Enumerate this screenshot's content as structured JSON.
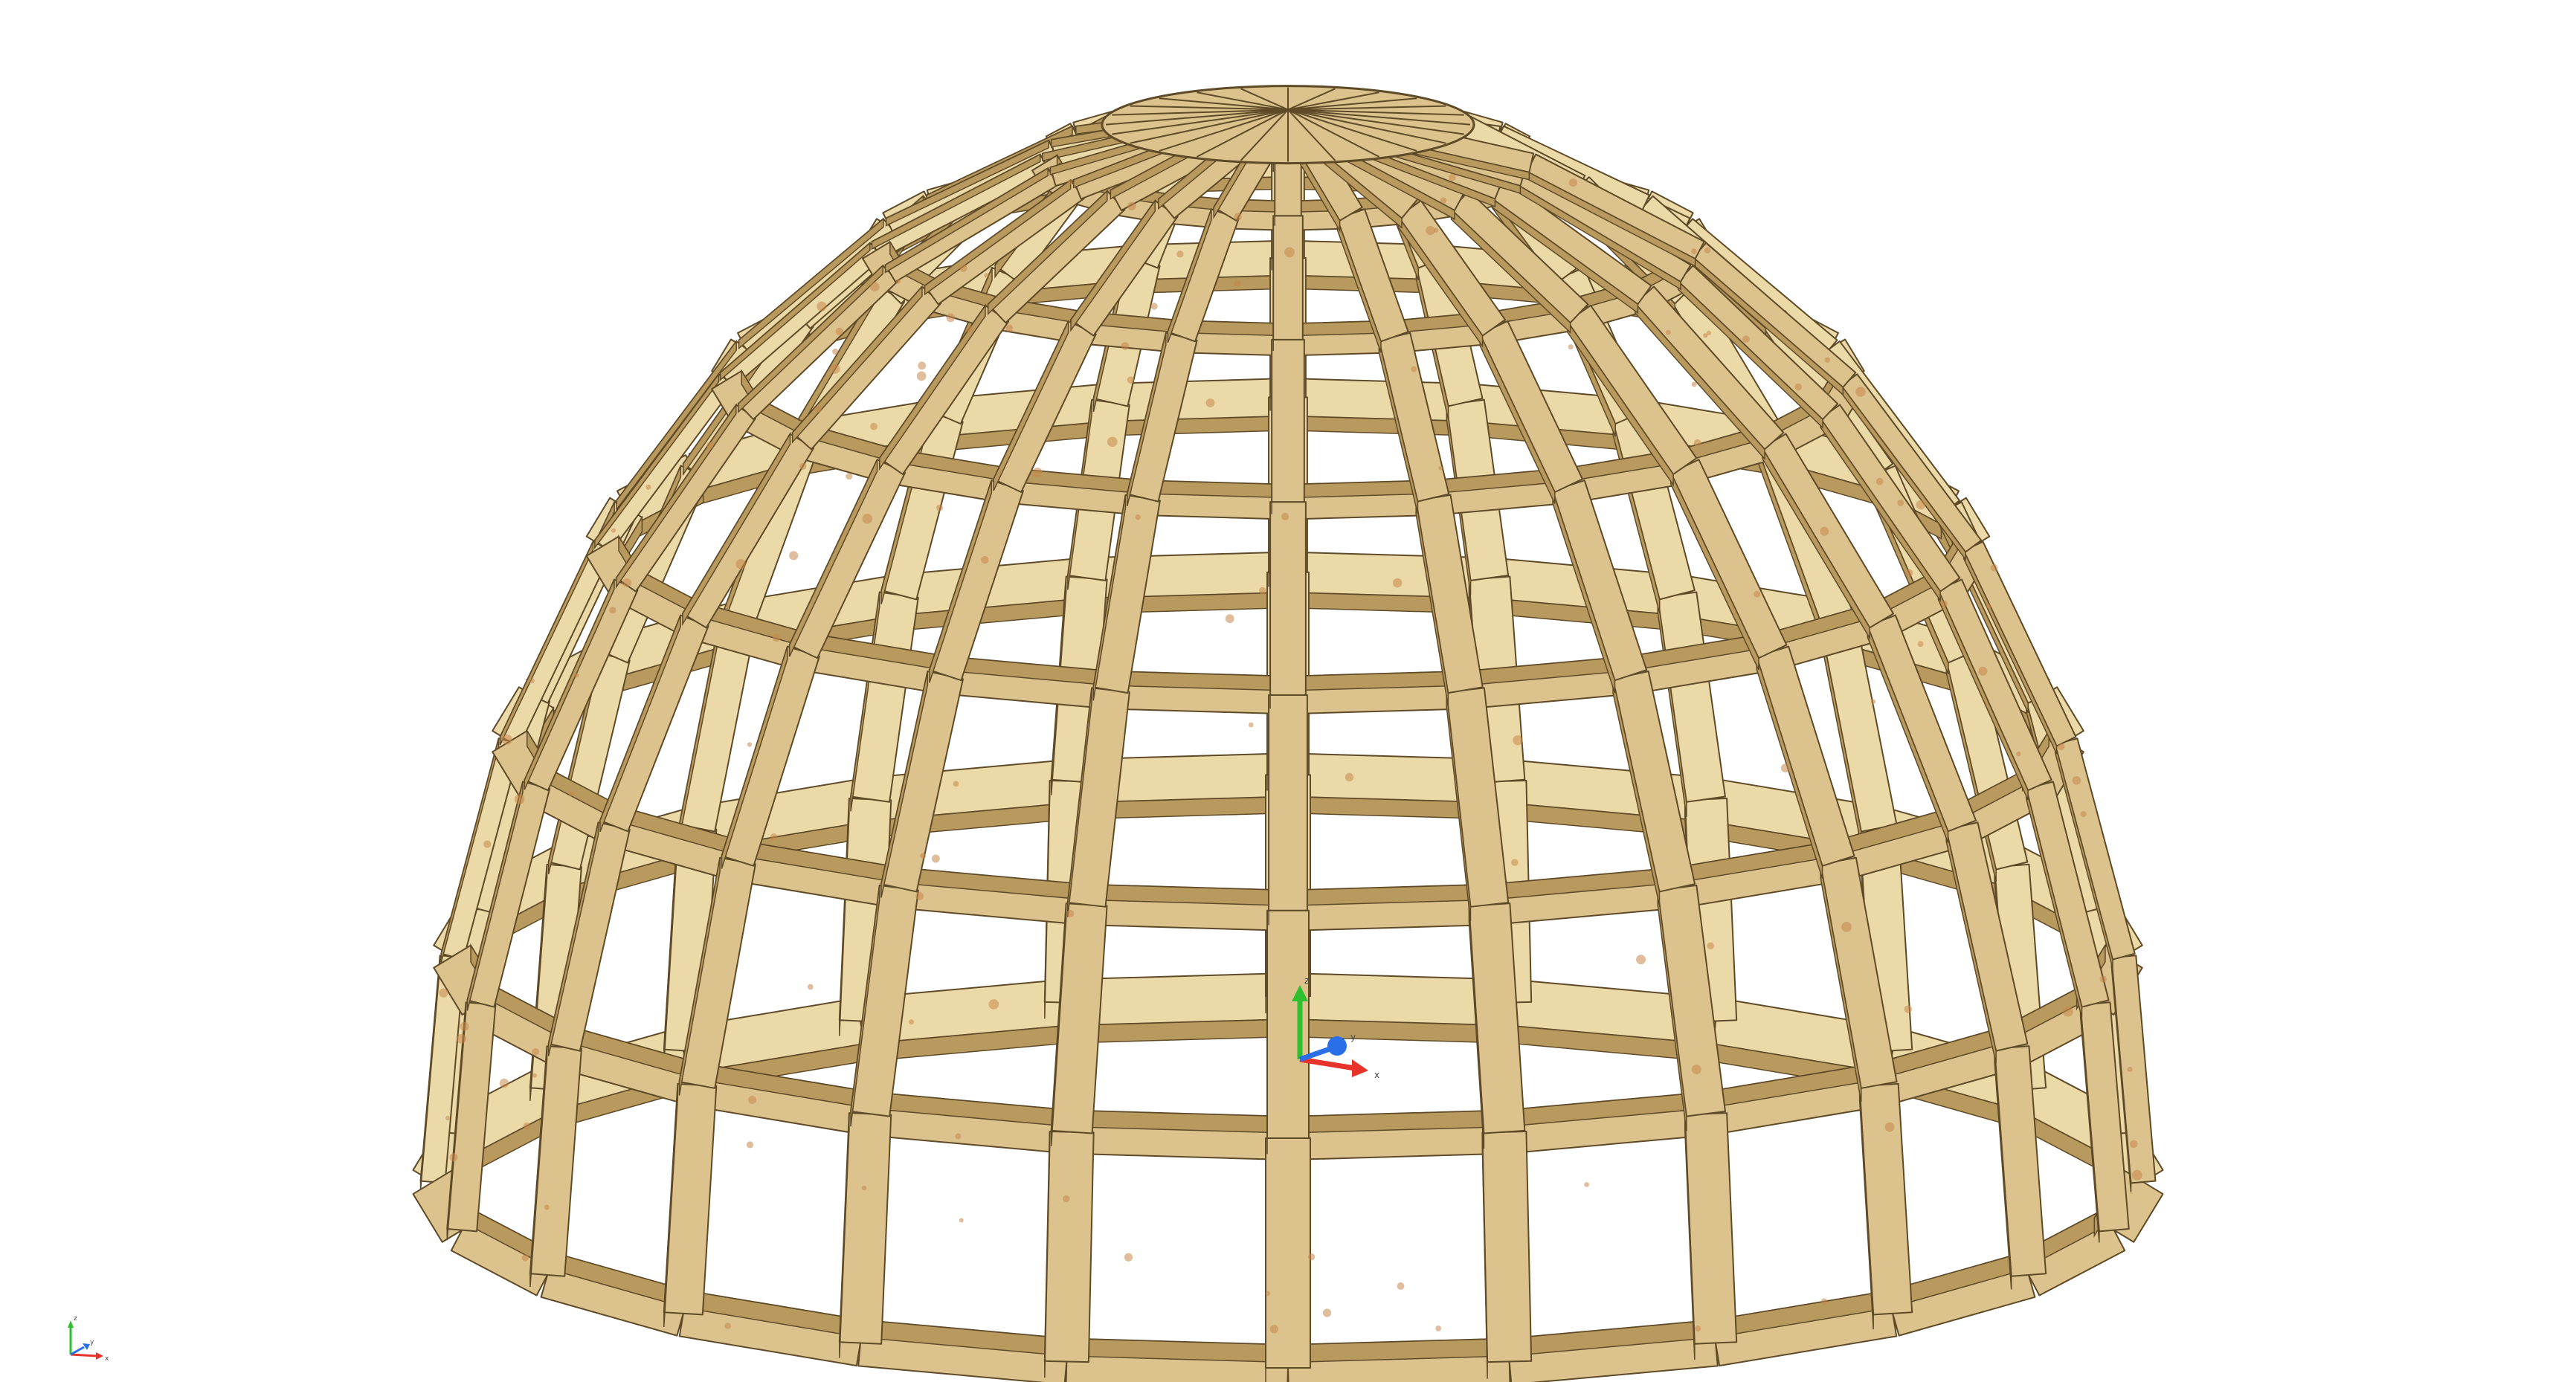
{
  "viewport": {
    "background": "#ffffff"
  },
  "model": {
    "name_icon": "timber-dome-frame",
    "rings": 7,
    "ribs": 24,
    "colors": {
      "wood_face": "#dcc38e",
      "wood_side": "#b99a5e",
      "wood_dark": "#8c7142",
      "wood_light": "#ecd9a8",
      "knot": "#c7874a",
      "edge": "#5f4a28"
    }
  },
  "axis_triad_center": {
    "labels": {
      "x": "x",
      "y": "y",
      "z": "z"
    },
    "colors": {
      "x": "#e8332a",
      "y": "#2a6fe8",
      "z": "#2ec02e"
    }
  },
  "axis_triad_corner": {
    "labels": {
      "x": "x",
      "y": "y",
      "z": "z"
    },
    "colors": {
      "x": "#e8332a",
      "y": "#2a6fe8",
      "z": "#2ec02e"
    }
  }
}
